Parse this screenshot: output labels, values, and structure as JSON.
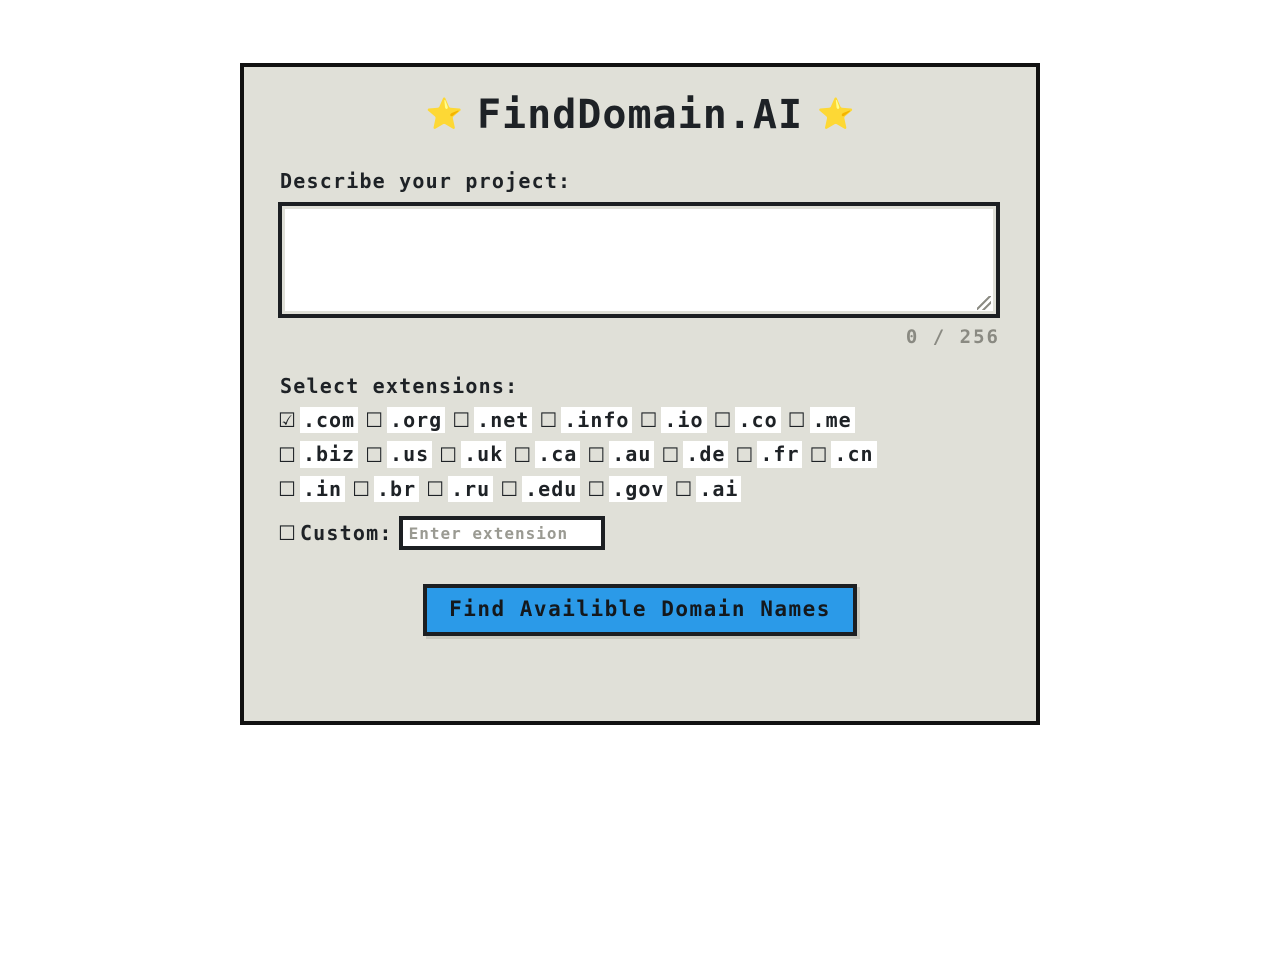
{
  "app": {
    "title": "FindDomain.AI",
    "star_left": "⭐",
    "star_right": "⭐",
    "accent_color": "#2b9ae8",
    "panel_bg": "#e0e0d8",
    "border_color": "#1c1f22"
  },
  "describe": {
    "label": "Describe your project:",
    "value": "",
    "placeholder": "",
    "counter": "0 / 256",
    "max_length": 256,
    "current_length": 0
  },
  "extensions": {
    "label": "Select extensions:",
    "checked_glyph": "☑",
    "unchecked_glyph": "☐",
    "rows": [
      [
        {
          "label": ".com",
          "checked": true
        },
        {
          "label": ".org",
          "checked": false
        },
        {
          "label": ".net",
          "checked": false
        },
        {
          "label": ".info",
          "checked": false
        },
        {
          "label": ".io",
          "checked": false
        },
        {
          "label": ".co",
          "checked": false
        },
        {
          "label": ".me",
          "checked": false
        }
      ],
      [
        {
          "label": ".biz",
          "checked": false
        },
        {
          "label": ".us",
          "checked": false
        },
        {
          "label": ".uk",
          "checked": false
        },
        {
          "label": ".ca",
          "checked": false
        },
        {
          "label": ".au",
          "checked": false
        },
        {
          "label": ".de",
          "checked": false
        },
        {
          "label": ".fr",
          "checked": false
        },
        {
          "label": ".cn",
          "checked": false
        }
      ],
      [
        {
          "label": ".in",
          "checked": false
        },
        {
          "label": ".br",
          "checked": false
        },
        {
          "label": ".ru",
          "checked": false
        },
        {
          "label": ".edu",
          "checked": false
        },
        {
          "label": ".gov",
          "checked": false
        },
        {
          "label": ".ai",
          "checked": false
        }
      ]
    ]
  },
  "custom": {
    "label": "Custom:",
    "checked": false,
    "input_value": "",
    "input_placeholder": "Enter extension"
  },
  "submit": {
    "label": "Find Availible Domain Names"
  }
}
